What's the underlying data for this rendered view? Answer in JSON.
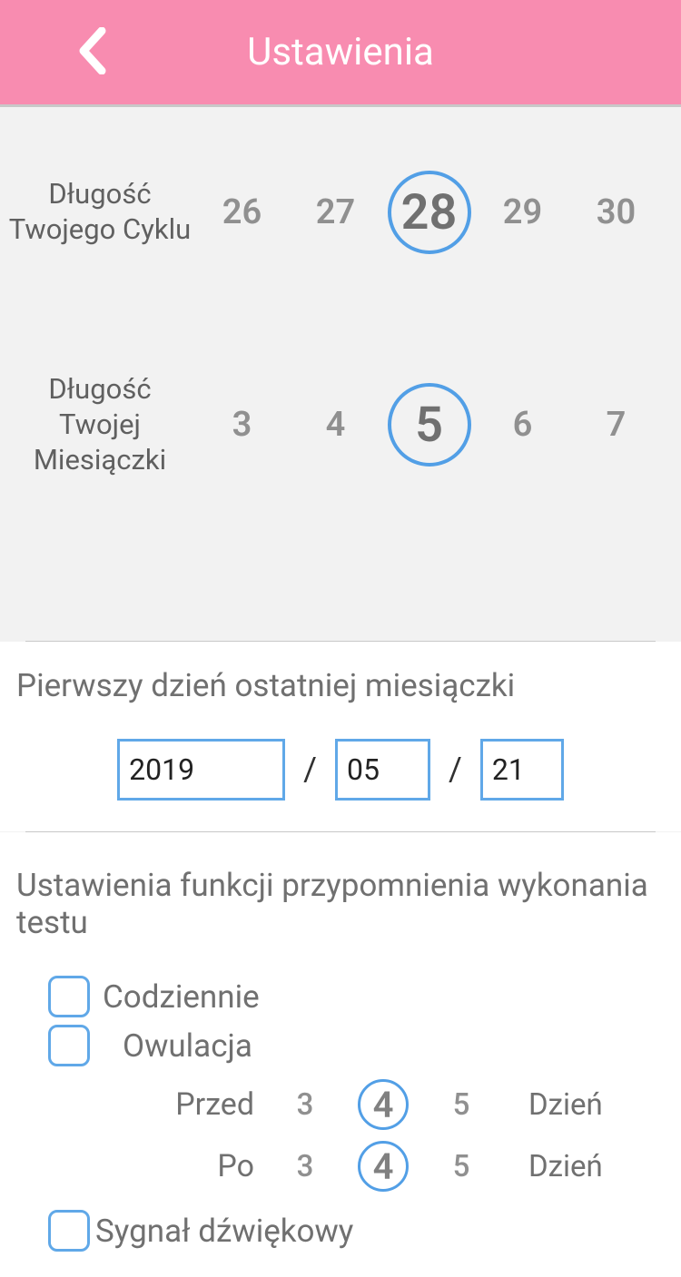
{
  "header": {
    "title": "Ustawienia"
  },
  "cycle": {
    "label": "Długość Twojego Cyklu",
    "options": [
      "26",
      "27",
      "28",
      "29",
      "30"
    ],
    "selected": "28"
  },
  "period": {
    "label": "Długość Twojej Miesiączki",
    "options": [
      "3",
      "4",
      "5",
      "6",
      "7"
    ],
    "selected": "5"
  },
  "firstDay": {
    "title": "Pierwszy dzień ostatniej miesiączki",
    "year": "2019",
    "month": "05",
    "day": "21",
    "sep": "/"
  },
  "reminder": {
    "title": "Ustawienia funkcji przypomnienia wykonania testu",
    "daily_label": "Codziennie",
    "ovulation_label": "Owulacja",
    "before": {
      "label": "Przed",
      "options": [
        "3",
        "4",
        "5"
      ],
      "selected": "4",
      "unit": "Dzień"
    },
    "after": {
      "label": "Po",
      "options": [
        "3",
        "4",
        "5"
      ],
      "selected": "4",
      "unit": "Dzień"
    },
    "sound_label": "Sygnał dźwiękowy"
  }
}
